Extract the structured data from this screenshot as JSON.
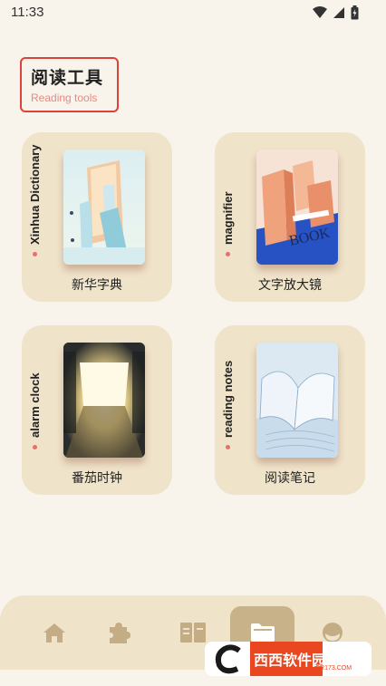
{
  "status": {
    "time": "11:33"
  },
  "header": {
    "title_zh": "阅读工具",
    "title_en": "Reading tools"
  },
  "cards": [
    {
      "side": "Xinhua Dictionary",
      "label": "新华字典"
    },
    {
      "side": "magnifier",
      "label": "文字放大镜"
    },
    {
      "side": "alarm clock",
      "label": "番茄时钟"
    },
    {
      "side": "reading notes",
      "label": "阅读笔记"
    }
  ],
  "thumb_text": {
    "book": "BOOK"
  },
  "tabbar": {
    "icons": [
      "home-icon",
      "puzzle-icon",
      "book-icon",
      "folder-icon",
      "profile-icon"
    ],
    "active_index": 3
  },
  "watermark": {
    "brand": "西西软件园",
    "url": "CR173.COM"
  },
  "colors": {
    "background": "#f8f3eb",
    "card": "#efe3c9",
    "accent_red": "#d9433a",
    "tab_active": "#c7b28a",
    "tab_icon": "#c4ad84"
  }
}
